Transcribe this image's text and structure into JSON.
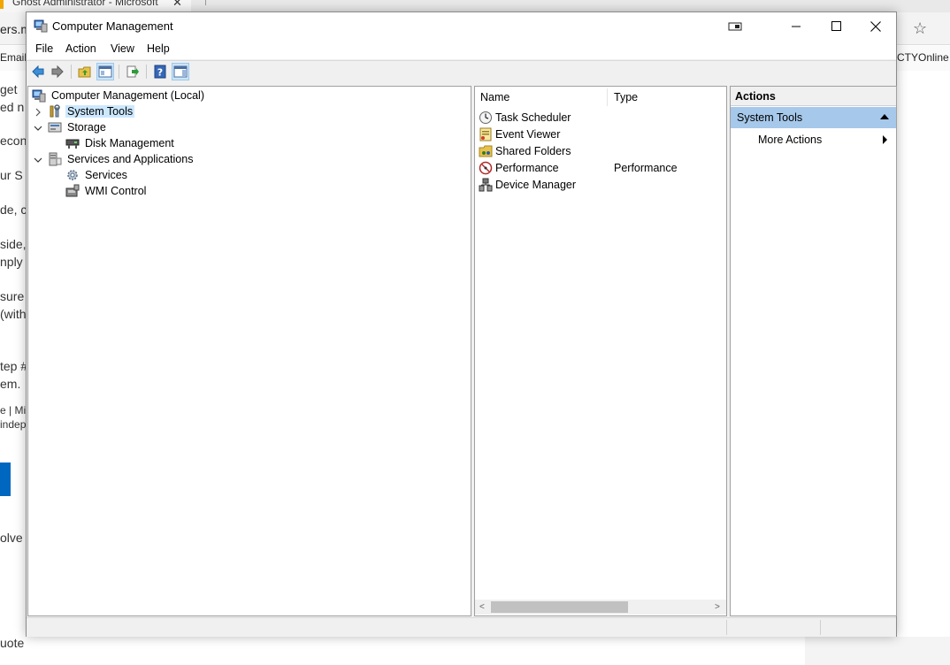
{
  "background": {
    "tab_title": "Ghost Administrator - Microsoft",
    "tab_close": "✕",
    "address_fragment": "ers.m",
    "bookmark_left": "Email",
    "bookmark_right": "CTYOnline",
    "article_lines": [
      "get",
      "ed n",
      "econ",
      "ur S",
      "de, c",
      "side,",
      "nply",
      "sure",
      "(with",
      "tep #",
      "em.",
      "e | Mic",
      "indep",
      "olve",
      "uote"
    ]
  },
  "window": {
    "title": "Computer Management",
    "menu": [
      "File",
      "Action",
      "View",
      "Help"
    ]
  },
  "tree": {
    "root": "Computer Management (Local)",
    "items": [
      {
        "label": "System Tools"
      },
      {
        "label": "Storage"
      },
      {
        "label": "Disk Management"
      },
      {
        "label": "Services and Applications"
      },
      {
        "label": "Services"
      },
      {
        "label": "WMI Control"
      }
    ]
  },
  "list": {
    "columns": [
      "Name",
      "Type"
    ],
    "rows": [
      {
        "name": "Task Scheduler",
        "type": "",
        "icon": "clock-icon"
      },
      {
        "name": "Event Viewer",
        "type": "",
        "icon": "event-log-icon"
      },
      {
        "name": "Shared Folders",
        "type": "",
        "icon": "shared-folder-icon"
      },
      {
        "name": "Performance",
        "type": "Performance",
        "icon": "performance-icon"
      },
      {
        "name": "Device Manager",
        "type": "",
        "icon": "device-manager-icon"
      }
    ]
  },
  "actions": {
    "header": "Actions",
    "section": "System Tools",
    "more": "More Actions"
  },
  "colors": {
    "selection": "#cce8ff",
    "actions_section": "#a6c8ea"
  }
}
